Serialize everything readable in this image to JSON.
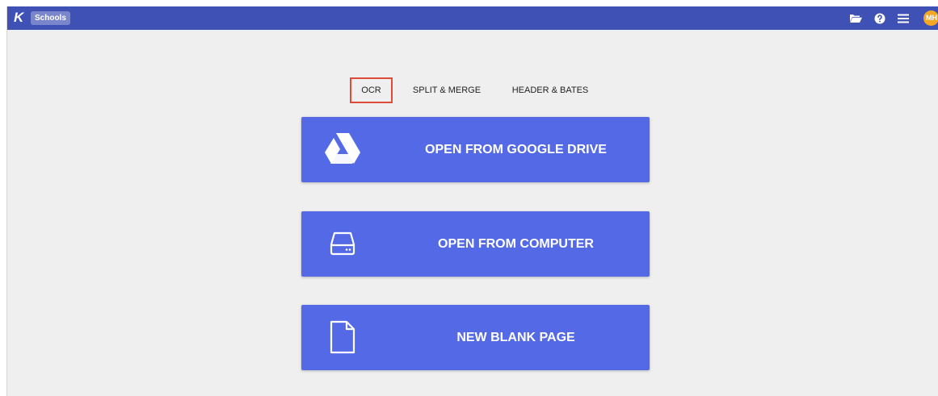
{
  "topbar": {
    "logo_letter": "K",
    "app_badge": "Schools",
    "avatar_initials": "MH",
    "icons": [
      "folder-open-icon",
      "help-icon",
      "menu-icon"
    ]
  },
  "tabs": [
    {
      "label": "OCR",
      "selected": true
    },
    {
      "label": "SPLIT & MERGE",
      "selected": false
    },
    {
      "label": "HEADER & BATES",
      "selected": false
    }
  ],
  "actions": [
    {
      "label": "OPEN FROM GOOGLE DRIVE",
      "icon": "google-drive-icon"
    },
    {
      "label": "OPEN FROM COMPUTER",
      "icon": "hard-drive-icon"
    },
    {
      "label": "NEW BLANK PAGE",
      "icon": "blank-page-icon"
    }
  ],
  "colors": {
    "topbar": "#3f51b5",
    "action_button": "#5469e6",
    "selected_tab_outline": "#e04a3a",
    "avatar": "#f5a623",
    "background": "#efefef"
  }
}
